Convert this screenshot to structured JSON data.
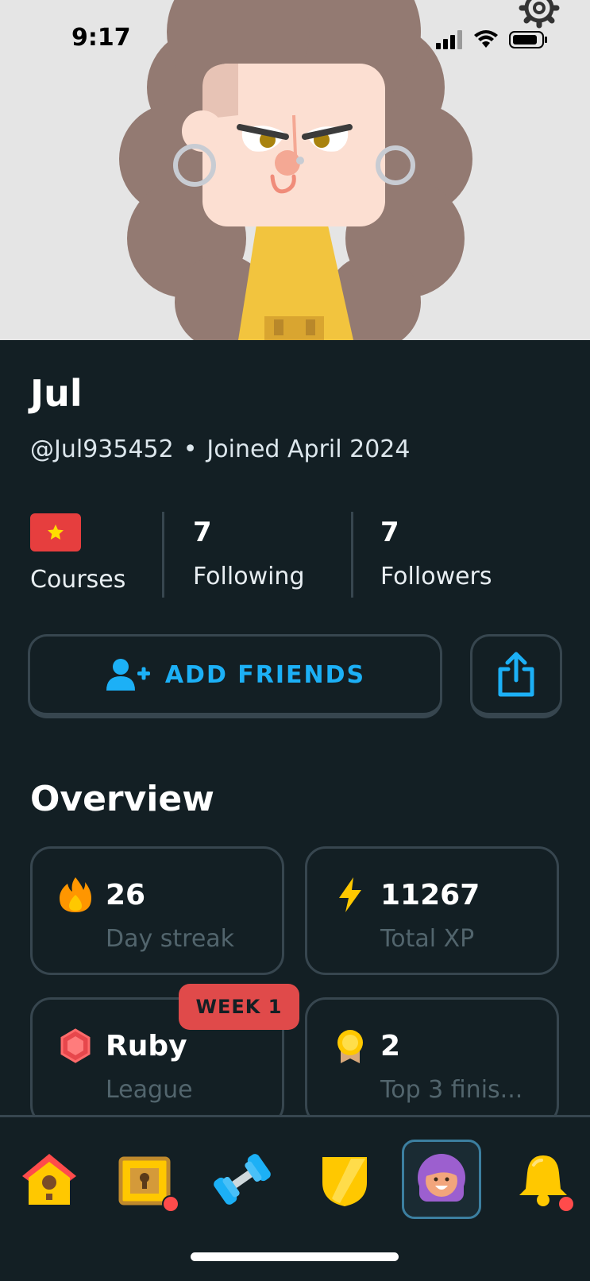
{
  "status_bar": {
    "time": "9:17"
  },
  "profile": {
    "display_name": "Jul",
    "username": "@Jul935452",
    "separator": "•",
    "joined": "Joined April 2024"
  },
  "stats": {
    "courses_label": "Courses",
    "following_count": "7",
    "following_label": "Following",
    "followers_count": "7",
    "followers_label": "Followers"
  },
  "actions": {
    "add_friends_label": "ADD FRIENDS"
  },
  "overview": {
    "title": "Overview",
    "cards": [
      {
        "value": "26",
        "label": "Day streak",
        "icon": "fire-icon"
      },
      {
        "value": "11267",
        "label": "Total XP",
        "icon": "lightning-icon"
      },
      {
        "value": "Ruby",
        "label": "League",
        "icon": "ruby-gem-icon",
        "badge": "WEEK 1"
      },
      {
        "value": "2",
        "label": "Top 3 finis...",
        "icon": "medal-icon"
      }
    ]
  },
  "tabs": [
    {
      "name": "home",
      "icon": "home-icon"
    },
    {
      "name": "chest",
      "icon": "treasure-chest-icon",
      "notification": true
    },
    {
      "name": "practice",
      "icon": "dumbbell-icon"
    },
    {
      "name": "leagues",
      "icon": "shield-icon"
    },
    {
      "name": "profile",
      "icon": "avatar-icon",
      "active": true
    },
    {
      "name": "notifications",
      "icon": "bell-icon",
      "notification": true
    }
  ],
  "colors": {
    "background": "#131f24",
    "border": "#37464f",
    "accent_blue": "#1cb0f6",
    "badge_red": "#e04a4a",
    "muted_text": "#52656d"
  }
}
